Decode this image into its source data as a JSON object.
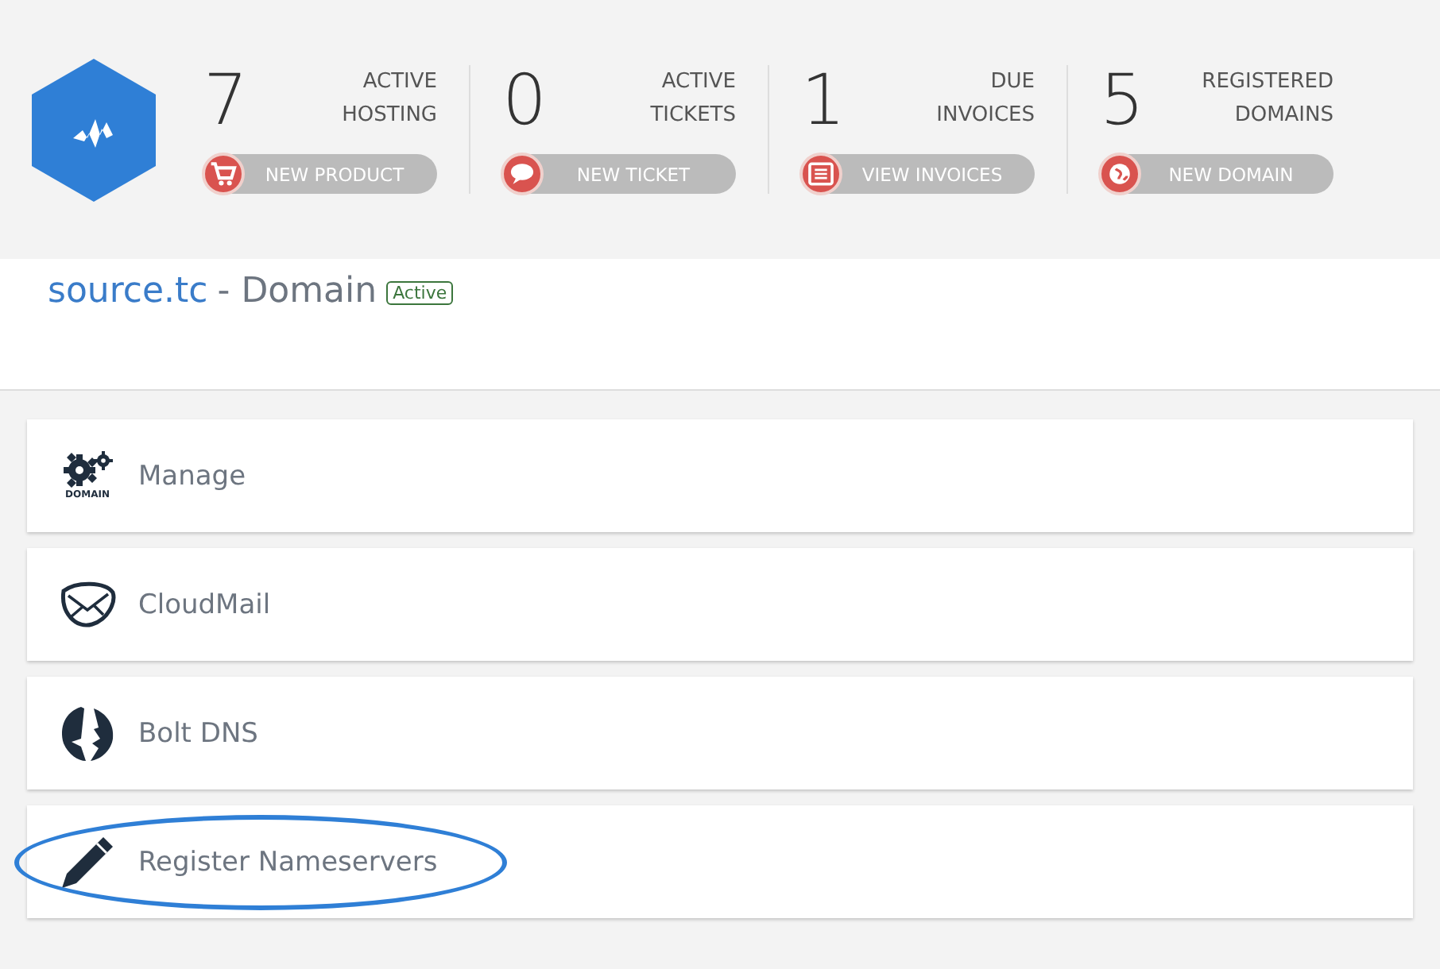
{
  "stats": [
    {
      "count": "7",
      "label_lines": [
        "ACTIVE",
        "HOSTING"
      ],
      "button": "NEW PRODUCT",
      "kind": "cart"
    },
    {
      "count": "0",
      "label_lines": [
        "ACTIVE",
        "TICKETS"
      ],
      "button": "NEW TICKET",
      "kind": "chat"
    },
    {
      "count": "1",
      "label_lines": [
        "DUE",
        "INVOICES"
      ],
      "button": "VIEW INVOICES",
      "kind": "list"
    },
    {
      "count": "5",
      "label_lines": [
        "REGISTERED",
        "DOMAINS"
      ],
      "button": "NEW DOMAIN",
      "kind": "globe"
    }
  ],
  "heading": {
    "domain": "source.tc",
    "suffix": "- Domain",
    "status": "Active"
  },
  "items": [
    {
      "label": "Manage",
      "kind": "gears",
      "icon_text": "DOMAIN",
      "highlighted": false
    },
    {
      "label": "CloudMail",
      "kind": "mail",
      "highlighted": false
    },
    {
      "label": "Bolt DNS",
      "kind": "bolt",
      "highlighted": false
    },
    {
      "label": "Register Nameservers",
      "kind": "pencil",
      "highlighted": true
    }
  ]
}
